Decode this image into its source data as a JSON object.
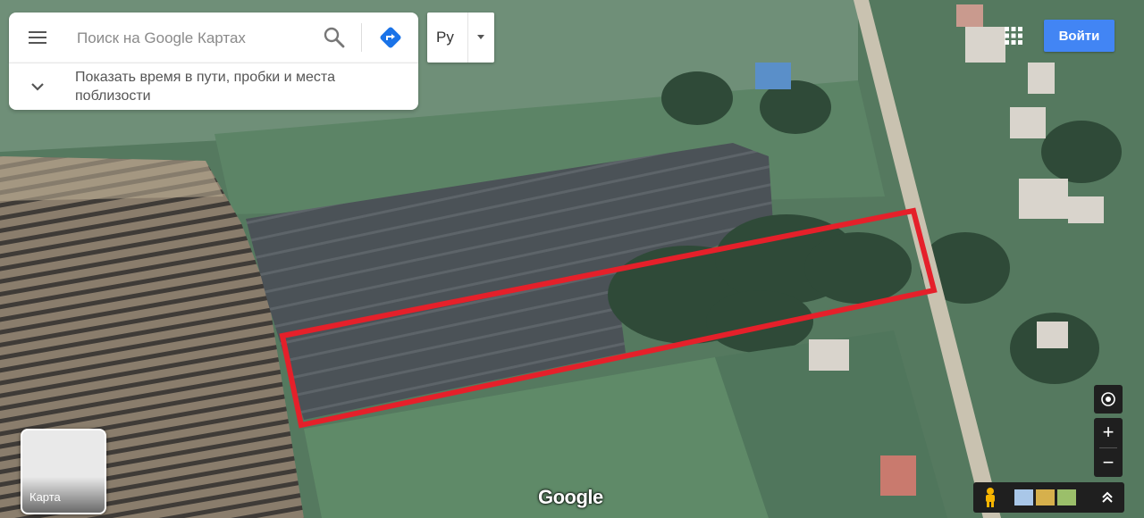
{
  "search": {
    "placeholder": "Поиск на Google Картах",
    "subtext": "Показать время в пути, пробки и места поблизости"
  },
  "language": {
    "label": "Ру"
  },
  "header": {
    "signin_label": "Войти"
  },
  "layer_switcher": {
    "label": "Карта"
  },
  "branding": {
    "logo_text": "Google"
  },
  "icons": {
    "menu": "menu-icon",
    "search": "search-icon",
    "directions": "directions-icon",
    "expand": "chevron-down-icon",
    "apps": "apps-grid-icon",
    "compass": "compass-icon",
    "pegman": "pegman-icon",
    "collapse": "chevron-up-icon"
  },
  "colors": {
    "accent": "#4285f4",
    "directions": "#1a73e8",
    "highlight_outline": "#e5202a",
    "controls_bg": "#1f1f1f"
  }
}
